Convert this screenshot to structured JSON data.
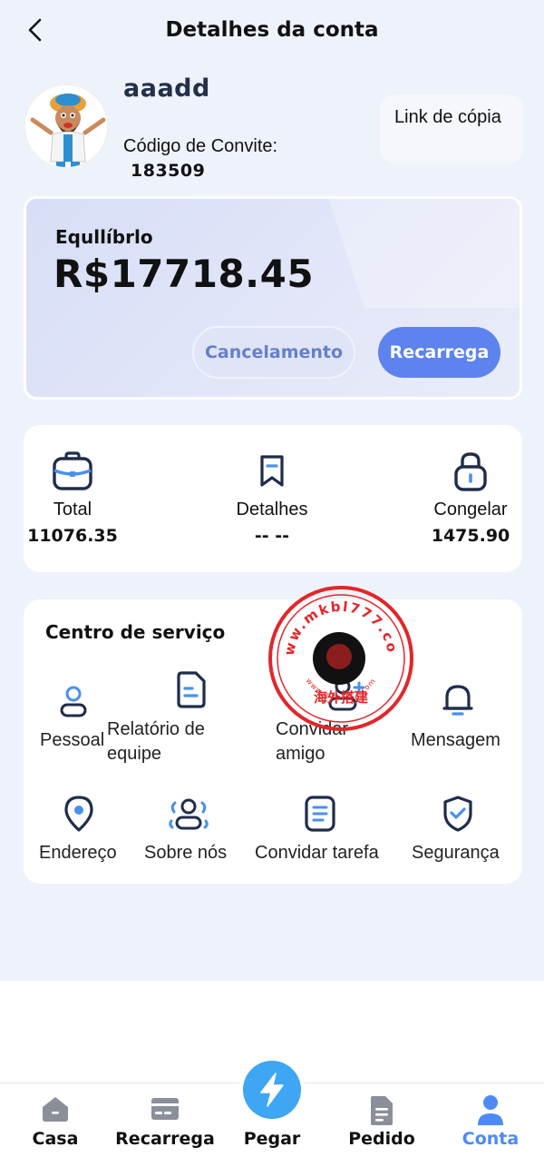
{
  "header": {
    "title": "Detalhes da conta"
  },
  "profile": {
    "username": "aaadd",
    "invite_label": "Código de Convite:",
    "invite_code": "183509",
    "copy_link": "Link de cópia"
  },
  "balance": {
    "label": "Equllíbrlo",
    "value": "R$17718.45",
    "cancel_label": "Cancelamento",
    "recharge_label": "Recarrega"
  },
  "stats": [
    {
      "label": "Total",
      "value": "11076.35",
      "icon": "briefcase-icon"
    },
    {
      "label": "Detalhes",
      "value": "-- --",
      "icon": "bookmark-icon"
    },
    {
      "label": "Congelar",
      "value": "1475.90",
      "icon": "lock-icon"
    }
  ],
  "service": {
    "title": "Centro de serviço",
    "items": [
      {
        "label": "Pessoal",
        "icon": "person-icon"
      },
      {
        "label": "Relatório de equipe",
        "line1": "Relatório de",
        "line2": "equipe",
        "icon": "report-icon"
      },
      {
        "label": "Convidar amigo",
        "line1": "Convidar",
        "line2": "amigo",
        "icon": "add-friend-icon"
      },
      {
        "label": "Mensagem",
        "icon": "bell-icon"
      },
      {
        "label": "Endereço",
        "icon": "location-icon"
      },
      {
        "label": "Sobre nós",
        "icon": "group-icon"
      },
      {
        "label": "Convidar tarefa",
        "icon": "document-icon"
      },
      {
        "label": "Segurança",
        "icon": "shield-check-icon"
      }
    ]
  },
  "watermark": {
    "top_text": "www.mkbl777.com",
    "center_text": "海外搭建",
    "bottom_text": "www.mkbl777.com"
  },
  "nav": [
    {
      "label": "Casa",
      "icon": "home-icon",
      "active": false
    },
    {
      "label": "Recarrega",
      "icon": "card-icon",
      "active": false
    },
    {
      "label": "Pegar",
      "icon": "lightning-icon",
      "active": false
    },
    {
      "label": "Pedido",
      "icon": "order-icon",
      "active": false
    },
    {
      "label": "Conta",
      "icon": "user-icon",
      "active": true
    }
  ],
  "colors": {
    "accent": "#5c83ee",
    "nav_active": "#4d8af7",
    "icon_blue": "#4a8ff0",
    "icon_dark": "#1f2d4a",
    "fab": "#3ea6f3"
  }
}
